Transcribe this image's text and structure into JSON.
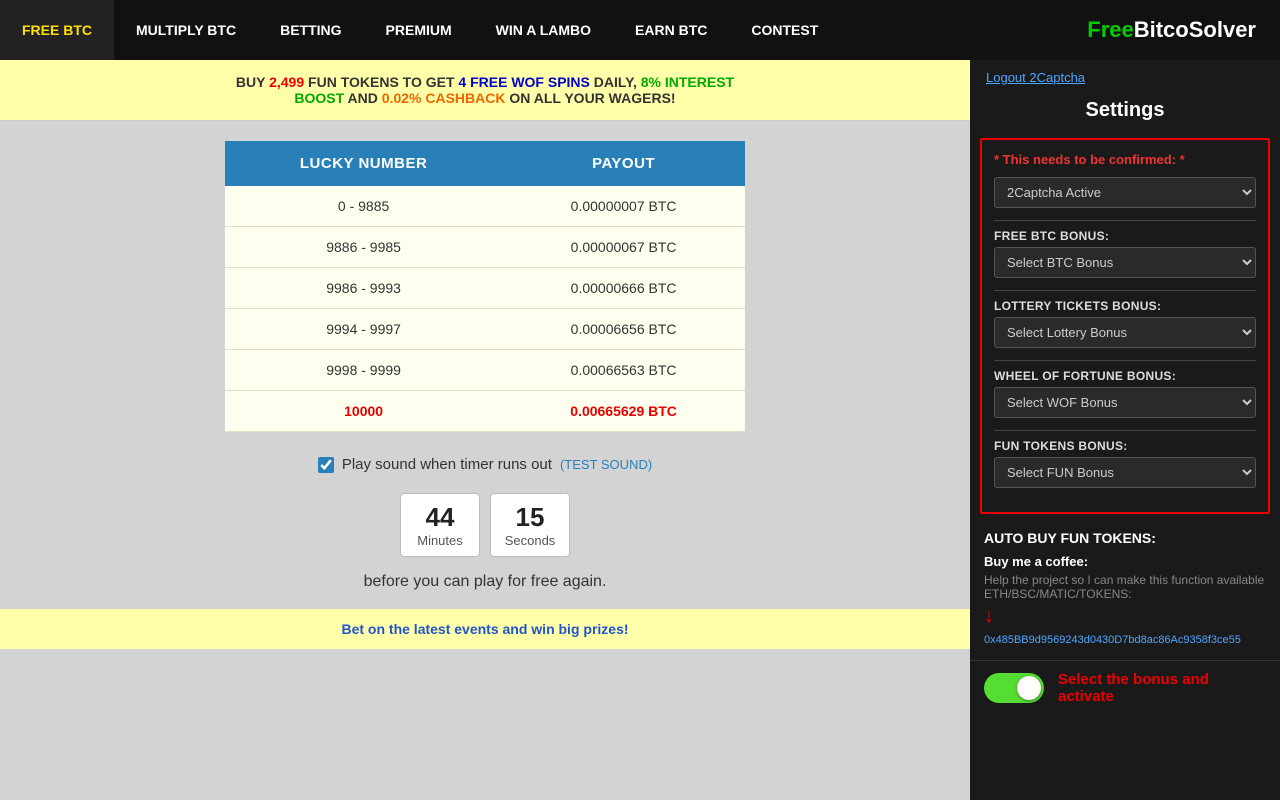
{
  "nav": {
    "items": [
      {
        "label": "FREE BTC",
        "active": true
      },
      {
        "label": "MULTIPLY BTC",
        "active": false
      },
      {
        "label": "BETTING",
        "active": false
      },
      {
        "label": "PREMIUM",
        "active": false
      },
      {
        "label": "WIN A LAMBO",
        "active": false
      },
      {
        "label": "EARN BTC",
        "active": false
      },
      {
        "label": "CONTEST",
        "active": false
      }
    ],
    "logo": {
      "free": "Free",
      "bitco": "Bitco",
      "solver": " Solver"
    }
  },
  "promo": {
    "part1": "BUY ",
    "highlight1": "2,499",
    "part2": " FUN TOKENS TO GET ",
    "highlight2": "4 FREE WOF SPINS",
    "part3": " DAILY, ",
    "highlight3": "8% INTEREST",
    "line2_part1": "BOOST",
    "line2_part2": " AND ",
    "highlight4": "0.02% CASHBACK",
    "line2_part3": " ON ALL YOUR WAGERS!"
  },
  "table": {
    "col1": "LUCKY NUMBER",
    "col2": "PAYOUT",
    "rows": [
      {
        "lucky": "0 - 9885",
        "payout": "0.00000007 BTC"
      },
      {
        "lucky": "9886 - 9985",
        "payout": "0.00000067 BTC"
      },
      {
        "lucky": "9986 - 9993",
        "payout": "0.00000666 BTC"
      },
      {
        "lucky": "9994 - 9997",
        "payout": "0.00006656 BTC"
      },
      {
        "lucky": "9998 - 9999",
        "payout": "0.00066563 BTC"
      },
      {
        "lucky": "10000",
        "payout": "0.00665629 BTC"
      }
    ]
  },
  "sound": {
    "label": "Play sound when timer runs out",
    "test_label": "(TEST SOUND)"
  },
  "timer": {
    "minutes_val": "44",
    "minutes_label": "Minutes",
    "seconds_val": "15",
    "seconds_label": "Seconds"
  },
  "free_again": {
    "text": "before you can play for free again."
  },
  "bottom_banner": {
    "text": "Bet on the latest events and win big prizes!"
  },
  "sidebar": {
    "logout_text": "Logout 2Captcha",
    "settings_title": "Settings",
    "warning": "* This needs to be confirmed: *",
    "captcha_label": "",
    "captcha_options": [
      "2Captcha Active"
    ],
    "captcha_selected": "2Captcha Active",
    "btc_bonus_label": "FREE BTC BONUS:",
    "btc_bonus_options": [
      "Select BTC Bonus"
    ],
    "btc_bonus_selected": "Select BTC Bonus",
    "lottery_label": "LOTTERY TICKETS BONUS:",
    "lottery_options": [
      "Select Lottery Bonus"
    ],
    "lottery_selected": "Select Lottery Bonus",
    "wof_label": "WHEEL OF FORTUNE BONUS:",
    "wof_options": [
      "Select WOF Bonus"
    ],
    "wof_selected": "Select WOF Bonus",
    "fun_label": "FUN TOKENS BONUS:",
    "fun_options": [
      "Select FUN Bonus"
    ],
    "fun_selected": "Select FUN Bonus",
    "auto_buy_title": "AUTO BUY FUN TOKENS:",
    "buy_coffee_title": "Buy me a coffee:",
    "buy_coffee_desc": "Help the project so I can make this function available ETH/BSC/MATIC/TOKENS:",
    "eth_address": "0x485BB9d9569243d0430D7bd8ac86Ac9358f3ce55",
    "toggle_label": "Select the bonus and activate"
  }
}
